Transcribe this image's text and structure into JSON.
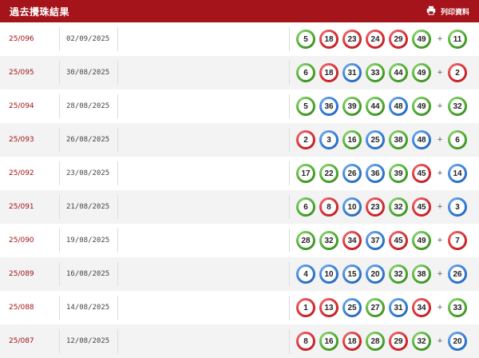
{
  "header": {
    "title": "過去攪珠結果",
    "print_label": "列印資料"
  },
  "colors": {
    "red": "#d3292f",
    "blue": "#2f79d3",
    "green": "#4aa62d",
    "header_bg": "#a4141a"
  },
  "results": [
    {
      "draw": "25/096",
      "date": "02/09/2025",
      "numbers": [
        {
          "n": "5",
          "c": "green"
        },
        {
          "n": "18",
          "c": "red"
        },
        {
          "n": "23",
          "c": "red"
        },
        {
          "n": "24",
          "c": "red"
        },
        {
          "n": "29",
          "c": "red"
        },
        {
          "n": "49",
          "c": "green"
        }
      ],
      "special": {
        "n": "11",
        "c": "green"
      }
    },
    {
      "draw": "25/095",
      "date": "30/08/2025",
      "numbers": [
        {
          "n": "6",
          "c": "green"
        },
        {
          "n": "18",
          "c": "red"
        },
        {
          "n": "31",
          "c": "blue"
        },
        {
          "n": "33",
          "c": "green"
        },
        {
          "n": "44",
          "c": "green"
        },
        {
          "n": "49",
          "c": "green"
        }
      ],
      "special": {
        "n": "2",
        "c": "red"
      }
    },
    {
      "draw": "25/094",
      "date": "28/08/2025",
      "numbers": [
        {
          "n": "5",
          "c": "green"
        },
        {
          "n": "36",
          "c": "blue"
        },
        {
          "n": "39",
          "c": "green"
        },
        {
          "n": "44",
          "c": "green"
        },
        {
          "n": "48",
          "c": "blue"
        },
        {
          "n": "49",
          "c": "green"
        }
      ],
      "special": {
        "n": "32",
        "c": "green"
      }
    },
    {
      "draw": "25/093",
      "date": "26/08/2025",
      "numbers": [
        {
          "n": "2",
          "c": "red"
        },
        {
          "n": "3",
          "c": "blue"
        },
        {
          "n": "16",
          "c": "green"
        },
        {
          "n": "25",
          "c": "blue"
        },
        {
          "n": "38",
          "c": "green"
        },
        {
          "n": "48",
          "c": "blue"
        }
      ],
      "special": {
        "n": "6",
        "c": "green"
      }
    },
    {
      "draw": "25/092",
      "date": "23/08/2025",
      "numbers": [
        {
          "n": "17",
          "c": "green"
        },
        {
          "n": "22",
          "c": "green"
        },
        {
          "n": "26",
          "c": "blue"
        },
        {
          "n": "36",
          "c": "blue"
        },
        {
          "n": "39",
          "c": "green"
        },
        {
          "n": "45",
          "c": "red"
        }
      ],
      "special": {
        "n": "14",
        "c": "blue"
      }
    },
    {
      "draw": "25/091",
      "date": "21/08/2025",
      "numbers": [
        {
          "n": "6",
          "c": "green"
        },
        {
          "n": "8",
          "c": "red"
        },
        {
          "n": "10",
          "c": "blue"
        },
        {
          "n": "23",
          "c": "red"
        },
        {
          "n": "32",
          "c": "green"
        },
        {
          "n": "45",
          "c": "red"
        }
      ],
      "special": {
        "n": "3",
        "c": "blue"
      }
    },
    {
      "draw": "25/090",
      "date": "19/08/2025",
      "numbers": [
        {
          "n": "28",
          "c": "green"
        },
        {
          "n": "32",
          "c": "green"
        },
        {
          "n": "34",
          "c": "red"
        },
        {
          "n": "37",
          "c": "blue"
        },
        {
          "n": "45",
          "c": "red"
        },
        {
          "n": "49",
          "c": "green"
        }
      ],
      "special": {
        "n": "7",
        "c": "red"
      }
    },
    {
      "draw": "25/089",
      "date": "16/08/2025",
      "numbers": [
        {
          "n": "4",
          "c": "blue"
        },
        {
          "n": "10",
          "c": "blue"
        },
        {
          "n": "15",
          "c": "blue"
        },
        {
          "n": "20",
          "c": "blue"
        },
        {
          "n": "32",
          "c": "green"
        },
        {
          "n": "38",
          "c": "green"
        }
      ],
      "special": {
        "n": "26",
        "c": "blue"
      }
    },
    {
      "draw": "25/088",
      "date": "14/08/2025",
      "numbers": [
        {
          "n": "1",
          "c": "red"
        },
        {
          "n": "13",
          "c": "red"
        },
        {
          "n": "25",
          "c": "blue"
        },
        {
          "n": "27",
          "c": "green"
        },
        {
          "n": "31",
          "c": "blue"
        },
        {
          "n": "34",
          "c": "red"
        }
      ],
      "special": {
        "n": "33",
        "c": "green"
      }
    },
    {
      "draw": "25/087",
      "date": "12/08/2025",
      "numbers": [
        {
          "n": "8",
          "c": "red"
        },
        {
          "n": "16",
          "c": "green"
        },
        {
          "n": "18",
          "c": "red"
        },
        {
          "n": "28",
          "c": "green"
        },
        {
          "n": "29",
          "c": "red"
        },
        {
          "n": "32",
          "c": "green"
        }
      ],
      "special": {
        "n": "20",
        "c": "blue"
      }
    }
  ]
}
